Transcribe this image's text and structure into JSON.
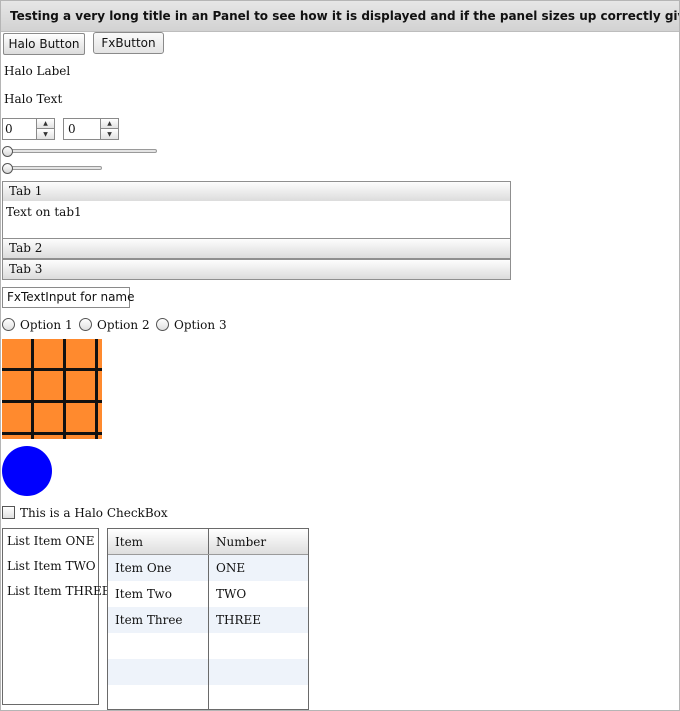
{
  "panel": {
    "title": "Testing a very long title in an Panel to see how it is displayed and if the panel sizes up correctly given the length"
  },
  "buttons": {
    "halo_button": "Halo Button",
    "fx_button": "FxButton"
  },
  "labels": {
    "halo_label": "Halo Label",
    "halo_text": "Halo Text"
  },
  "steppers": [
    {
      "value": "0"
    },
    {
      "value": "0"
    }
  ],
  "accordion": {
    "tabs": [
      {
        "label": "Tab 1",
        "content": "Text on tab1"
      },
      {
        "label": "Tab 2"
      },
      {
        "label": "Tab 3"
      }
    ]
  },
  "text_input": {
    "value": "FxTextInput for name"
  },
  "radio_options": [
    {
      "label": "Option 1"
    },
    {
      "label": "Option 2"
    },
    {
      "label": "Option 3"
    }
  ],
  "grid_color": "#ff8a2e",
  "circle_color": "#0000ff",
  "checkbox": {
    "label": "This is a Halo CheckBox"
  },
  "list": {
    "items": [
      "List Item ONE",
      "List Item TWO",
      "List Item THREE"
    ]
  },
  "datagrid": {
    "columns": [
      "Item",
      "Number"
    ],
    "rows": [
      [
        "Item One",
        "ONE"
      ],
      [
        "Item Two",
        "TWO"
      ],
      [
        "Item Three",
        "THREE"
      ]
    ]
  }
}
